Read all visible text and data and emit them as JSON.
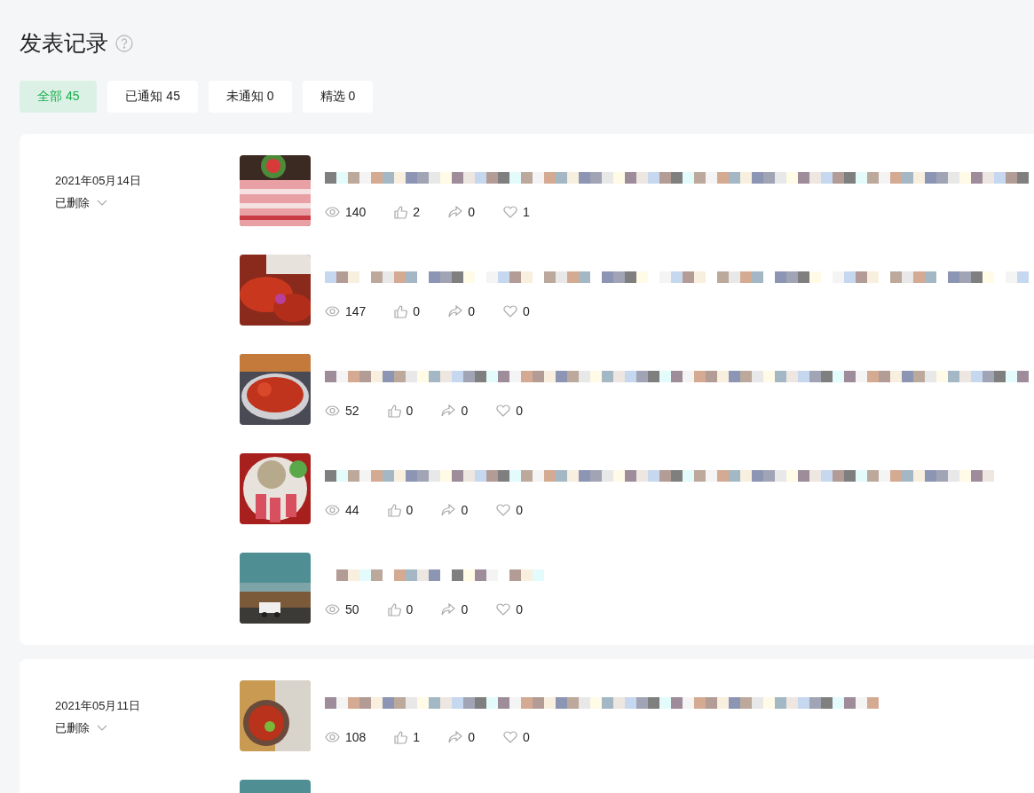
{
  "page": {
    "title": "发表记录"
  },
  "tabs": [
    {
      "label": "全部 45",
      "selected": true
    },
    {
      "label": "已通知 45",
      "selected": false
    },
    {
      "label": "未通知 0",
      "selected": false
    },
    {
      "label": "精选 0",
      "selected": false
    }
  ],
  "groups": [
    {
      "date": "2021年05月14日",
      "status": "已删除",
      "posts": [
        {
          "kind": "post",
          "views": "140",
          "likes": "2",
          "shares": "0",
          "favorites": "1"
        },
        {
          "kind": "post",
          "views": "147",
          "likes": "0",
          "shares": "0",
          "favorites": "0"
        },
        {
          "kind": "post",
          "views": "52",
          "likes": "0",
          "shares": "0",
          "favorites": "0"
        },
        {
          "kind": "post",
          "views": "44",
          "likes": "0",
          "shares": "0",
          "favorites": "0"
        },
        {
          "kind": "post",
          "views": "50",
          "likes": "0",
          "shares": "0",
          "favorites": "0"
        }
      ]
    },
    {
      "date": "2021年05月11日",
      "status": "已删除",
      "posts": [
        {
          "kind": "post",
          "views": "108",
          "likes": "1",
          "shares": "0",
          "favorites": "0"
        },
        {
          "kind": "picture"
        }
      ]
    }
  ]
}
